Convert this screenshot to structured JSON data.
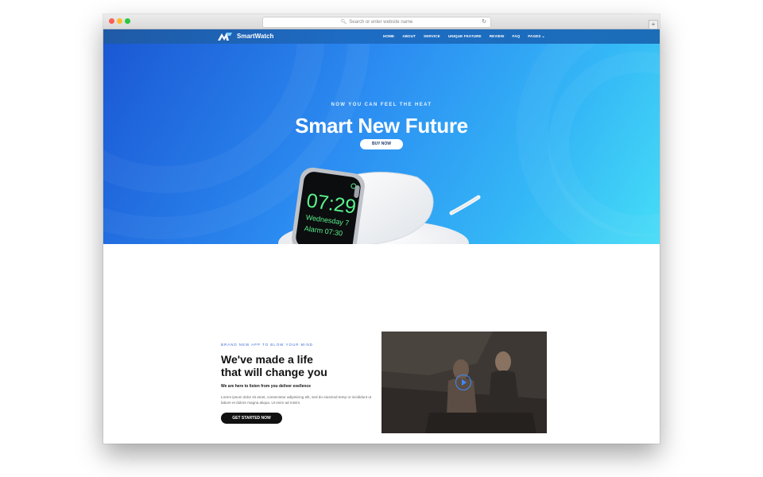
{
  "browser": {
    "url_placeholder": "Search or enter website name",
    "search_icon": "magnifier-icon",
    "reload_icon": "reload-icon",
    "new_tab_glyph": "+"
  },
  "nav": {
    "brand": "SmartWatch",
    "links": [
      "HOME",
      "ABOUT",
      "SERVICE",
      "UNIQUE FEATURE",
      "REVIEW",
      "FAQ",
      "PAGES"
    ],
    "dropdown_glyph": "⌄"
  },
  "hero": {
    "tagline": "NOW YOU CAN FEEL THE HEAT",
    "title": "Smart New Future",
    "cta": "BUY NOW",
    "watch": {
      "time": "07:29",
      "day": "Wednesday 7",
      "alarm": "Alarm 07:30"
    }
  },
  "section": {
    "eyebrow": "BRAND NEW APP TO BLOW YOUR MIND",
    "title_line1": "We've made a life",
    "title_line2": "that will change you",
    "subtitle": "We are here to listen from you deliver exellence",
    "body": "Lorem ipsum dolor sit amet, consectetur adipisicing elit, sed do eiusmod temp or incididunt ut labore et dolore magna aliqua. Ut enim ad minim.",
    "cta": "GET STARTED NOW",
    "play_icon": "play-icon"
  },
  "colors": {
    "hero_start": "#1b58d4",
    "hero_end": "#45ddf7",
    "nav_bg": "#1d6cc4",
    "accent": "#3a8bff",
    "dark_button": "#111111"
  }
}
